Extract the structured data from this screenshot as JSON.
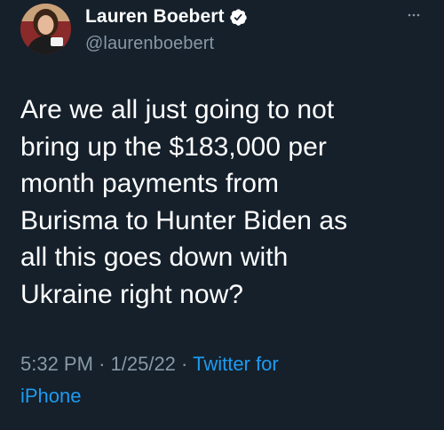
{
  "author": {
    "display_name": "Lauren Boebert",
    "handle": "@laurenboebert",
    "verified": true
  },
  "tweet": {
    "text_lines": [
      "Are we all just going to not",
      "bring up the $183,000 per",
      "month payments from",
      "Burisma to Hunter Biden as",
      "all this goes down with",
      "Ukraine right now?"
    ]
  },
  "meta": {
    "time": "5:32 PM",
    "separator": "·",
    "date": "1/25/22",
    "source_part1": "Twitter for",
    "source_part2": "iPhone"
  },
  "icons": {
    "more": "more-options-icon",
    "verified": "verified-badge-icon"
  },
  "colors": {
    "background": "#15202b",
    "primary_text": "#ffffff",
    "secondary_text": "#8899a6",
    "link": "#1d9bf0"
  }
}
